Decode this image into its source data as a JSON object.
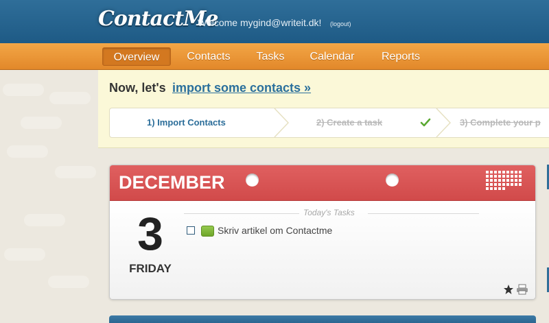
{
  "header": {
    "logo": "ContactMe",
    "welcome": "Welcome mygind@writeit.dk!",
    "logout_label": "(logout)"
  },
  "nav": {
    "items": [
      {
        "label": "Overview",
        "active": true
      },
      {
        "label": "Contacts",
        "active": false
      },
      {
        "label": "Tasks",
        "active": false
      },
      {
        "label": "Calendar",
        "active": false
      },
      {
        "label": "Reports",
        "active": false
      }
    ]
  },
  "banner": {
    "lead": "Now, let's",
    "link": "import some contacts »",
    "steps": [
      {
        "label": "1) Import Contacts",
        "state": "current"
      },
      {
        "label": "2) Create a task",
        "state": "done"
      },
      {
        "label": "3) Complete your p",
        "state": "done"
      }
    ]
  },
  "calendar": {
    "month": "DECEMBER",
    "day_number": "3",
    "day_name": "FRIDAY",
    "tasks_title": "Today's Tasks",
    "tasks": [
      {
        "text": "Skriv artikel om Contactme",
        "checked": false,
        "tag_color": "#7fb83a"
      }
    ]
  },
  "colors": {
    "header_blue": "#245f8b",
    "nav_orange": "#e8902f",
    "calendar_red": "#d94f4f",
    "banner_bg": "#fbf8d8",
    "link_blue": "#2a6f9c"
  }
}
